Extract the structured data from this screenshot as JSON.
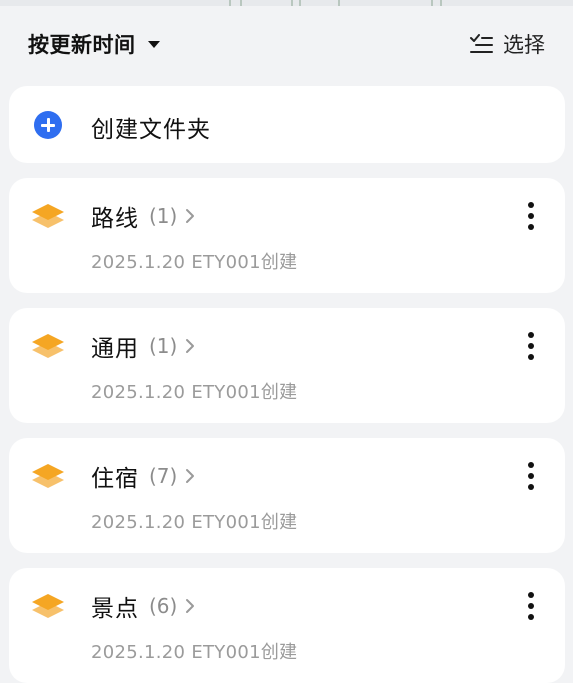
{
  "header": {
    "sort_label": "按更新时间",
    "select_label": "选择"
  },
  "create": {
    "label": "创建文件夹"
  },
  "folders": [
    {
      "name": "路线",
      "count": "(1)",
      "meta": "2025.1.20 ETY001创建"
    },
    {
      "name": "通用",
      "count": "(1)",
      "meta": "2025.1.20 ETY001创建"
    },
    {
      "name": "住宿",
      "count": "(7)",
      "meta": "2025.1.20 ETY001创建"
    },
    {
      "name": "景点",
      "count": "(6)",
      "meta": "2025.1.20 ETY001创建"
    }
  ],
  "icons": {
    "sort": "caret-down-icon",
    "select": "checklist-icon",
    "create": "plus-circle-icon",
    "folder": "layers-icon",
    "open": "chevron-right-icon",
    "more": "more-vertical-icon"
  },
  "colors": {
    "background": "#f2f3f5",
    "card": "#ffffff",
    "accent_blue": "#2f6ef0",
    "layers_orange": "#f5a623",
    "text_primary": "#111111",
    "text_secondary": "#9b9b9b"
  }
}
